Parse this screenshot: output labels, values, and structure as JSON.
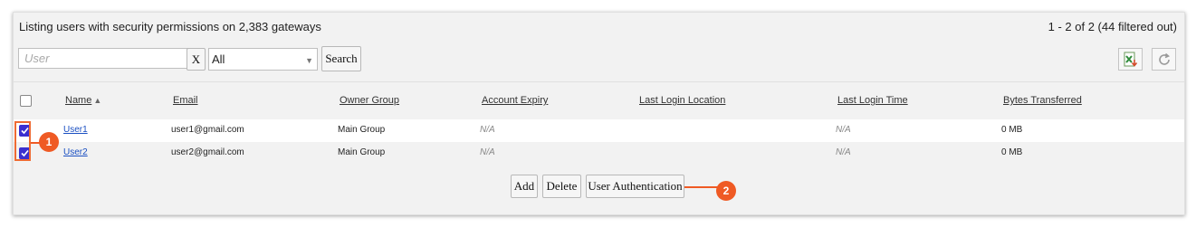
{
  "header": {
    "summary": "Listing users with security permissions on 2,383 gateways",
    "range": "1 - 2 of 2 (44 filtered out)"
  },
  "toolbar": {
    "search_placeholder": "User",
    "clear_label": "X",
    "filter_selected": "All",
    "search_label": "Search",
    "excel_icon": "excel-export-icon",
    "refresh_icon": "refresh-icon"
  },
  "table": {
    "columns": [
      "Name",
      "Email",
      "Owner Group",
      "Account Expiry",
      "Last Login Location",
      "Last Login Time",
      "Bytes Transferred"
    ],
    "sort_indicator": "▲",
    "rows": [
      {
        "name": "User1",
        "email": "user1@gmail.com",
        "owner_group": "Main Group",
        "account_expiry": "N/A",
        "last_login_location": "",
        "last_login_time": "N/A",
        "bytes_transferred": "0 MB",
        "checked": true
      },
      {
        "name": "User2",
        "email": "user2@gmail.com",
        "owner_group": "Main Group",
        "account_expiry": "N/A",
        "last_login_location": "",
        "last_login_time": "N/A",
        "bytes_transferred": "0 MB",
        "checked": true
      }
    ]
  },
  "actions": {
    "add_label": "Add",
    "delete_label": "Delete",
    "user_auth_label": "User Authentication"
  },
  "annotations": {
    "marker1": "1",
    "marker2": "2"
  },
  "colors": {
    "accent_marker": "#ef5a24",
    "checkbox": "#3b2fd0",
    "link": "#1a4fc2"
  }
}
